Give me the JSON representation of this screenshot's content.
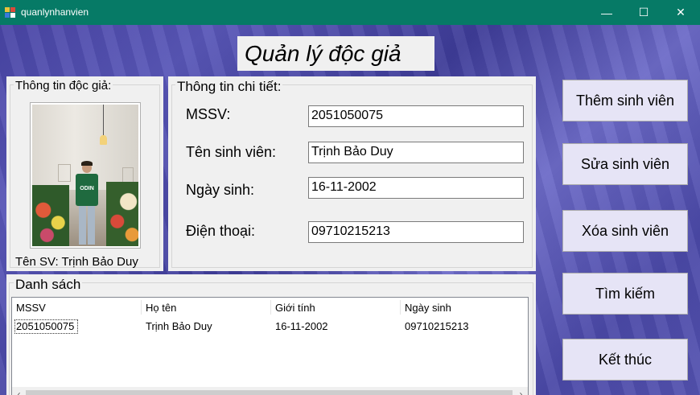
{
  "window": {
    "title": "quanlynhanvien",
    "minimize_glyph": "—",
    "maximize_glyph": "☐",
    "close_glyph": "✕"
  },
  "header": {
    "title": "Quản lý độc giả"
  },
  "reader_info": {
    "group_title": "Thông tin độc giả:",
    "name_caption": "Tên SV: Trịnh Bảo Duy",
    "photo_shirt_text": "ODIN"
  },
  "details": {
    "group_title": "Thông tin chi tiết:",
    "mssv_label": "MSSV:",
    "mssv_value": "2051050075",
    "name_label": "Tên sinh viên:",
    "name_value": "Trịnh Bảo Duy",
    "dob_label": "Ngày sinh:",
    "dob_value": "16-11-2002",
    "phone_label": "Điện thoại:",
    "phone_value": "09710215213"
  },
  "list": {
    "group_title": "Danh sách",
    "columns": [
      "MSSV",
      "Họ tên",
      "Giới tính",
      "Ngày sinh"
    ],
    "rows": [
      [
        "2051050075",
        "Trịnh Bảo Duy",
        "16-11-2002",
        "09710215213"
      ]
    ],
    "scroll_left": "‹",
    "scroll_right": "›"
  },
  "actions": {
    "add": "Thêm sinh viên",
    "edit": "Sửa sinh viên",
    "delete": "Xóa sinh viên",
    "search": "Tìm kiếm",
    "exit": "Kết thúc"
  },
  "colors": {
    "titlebar": "#067a66",
    "button_face": "#e6e4f6",
    "panel": "#f0f0f0"
  }
}
